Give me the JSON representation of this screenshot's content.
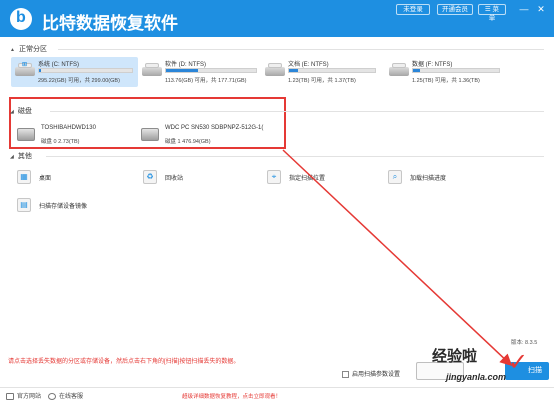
{
  "titlebar": {
    "app_title": "比特数据恢复软件",
    "btn_login": "未登录",
    "btn_vip": "开通会员",
    "btn_menu": "☰ 菜单",
    "win_min": "—",
    "win_close": "✕"
  },
  "sections": {
    "normal": "正常分区",
    "disks": "磁盘",
    "other": "其他"
  },
  "partitions": [
    {
      "name": "系统 (C: NTFS)",
      "info": "295.22(GB) 可用，共 299.00(GB)",
      "used": 0.02,
      "selected": true
    },
    {
      "name": "软件 (D: NTFS)",
      "info": "113.76(GB) 可用，共 177.71(GB)",
      "used": 0.36,
      "selected": false
    },
    {
      "name": "文档 (E: NTFS)",
      "info": "1.23(TB) 可用，共 1.37(TB)",
      "used": 0.1,
      "selected": false
    },
    {
      "name": "数据 (F: NTFS)",
      "info": "1.25(TB) 可用，共 1.36(TB)",
      "used": 0.08,
      "selected": false
    }
  ],
  "disks": [
    {
      "name": "TOSHIBAHDWD130",
      "info": "磁盘 0    2.73(TB)"
    },
    {
      "name": "WDC PC SN530 SDBPNPZ-512G-1(",
      "info": "磁盘 1    476.94(GB)"
    }
  ],
  "other_items": [
    {
      "label": "桌面",
      "icon": "desktop-icon",
      "glyph": "▦"
    },
    {
      "label": "回收站",
      "icon": "recycle-bin-icon",
      "glyph": "♻"
    },
    {
      "label": "指定扫描位置",
      "icon": "location-icon",
      "glyph": "⌖"
    },
    {
      "label": "加载扫描进度",
      "icon": "search-icon",
      "glyph": "⌕"
    },
    {
      "label": "扫描存储设备镜像",
      "icon": "disk-image-icon",
      "glyph": "▤"
    }
  ],
  "bottom": {
    "hint": "请点击选择丢失数据的分区或存储设备，然后点击右下角的[扫描]按钮扫描丢失的数据。",
    "advanced_label": "启用扫描参数设置",
    "advanced_checked": false,
    "version": "版本: 8.3.5",
    "back_label": "",
    "scan_label": "扫描"
  },
  "footer": {
    "website": "官方网站",
    "support": "在线客服",
    "promo": "超级详细数据恢复教程，点击立即观看！"
  },
  "watermark": {
    "text": "经验啦",
    "url": "jingyanla.com"
  },
  "colors": {
    "brand": "#1e8fe1",
    "highlight": "#e53935",
    "selection": "#cfe6fb"
  }
}
